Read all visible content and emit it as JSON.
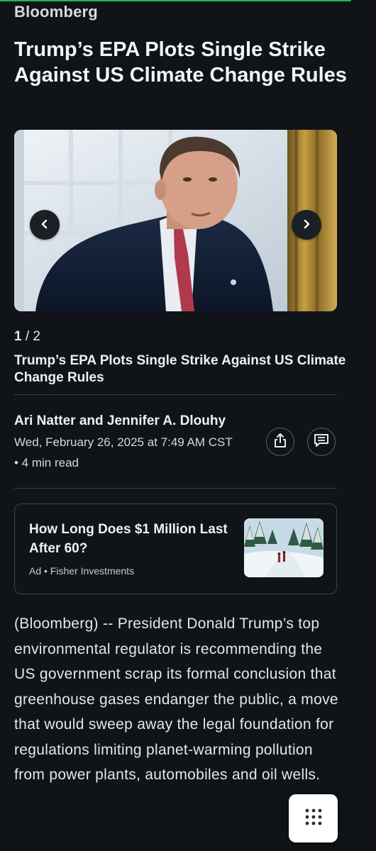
{
  "brand": "Bloomberg",
  "headline": "Trump’s EPA Plots Single Strike Against US Climate Change Rules",
  "gallery": {
    "current": "1",
    "separator": " / ",
    "total": "2",
    "prev_icon": "chevron-left-icon",
    "next_icon": "chevron-right-icon",
    "caption": "Trump’s EPA Plots Single Strike Against US Climate Change Rules"
  },
  "byline": {
    "authors": "Ari Natter and Jennifer A. Dlouhy",
    "date": "Wed, February 26, 2025 at 7:49 AM CST",
    "read_time": "• 4 min read",
    "share_icon": "share-icon",
    "comments_icon": "comments-icon"
  },
  "ad": {
    "title": "How Long Does $1 Million Last After 60?",
    "meta": "Ad • Fisher Investments"
  },
  "article": {
    "paragraph": "(Bloomberg) -- President Donald Trump’s top environmental regulator is recommending the US government scrap its formal conclusion that greenhouse gases endanger the public, a move that would sweep away the legal foundation for regulations limiting planet-warming pollution from power plants, automobiles and oil wells."
  },
  "floating": {
    "menu_icon": "grid-menu-icon"
  },
  "colors": {
    "background": "#101418",
    "accent": "#22b35e",
    "text": "#e8eaed"
  }
}
